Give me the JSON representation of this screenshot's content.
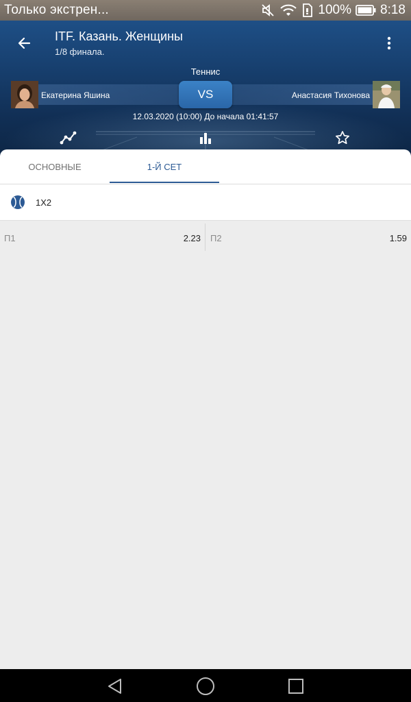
{
  "status_bar": {
    "notification": "Только экстрен...",
    "battery": "100%",
    "time": "8:18",
    "icons": [
      "mute-icon",
      "wifi-icon",
      "sim-icon",
      "battery-icon"
    ]
  },
  "header": {
    "title": "ITF. Казань. Женщины",
    "subtitle": "1/8 финала.",
    "sport": "Теннис",
    "vs": "VS",
    "datetime": "12.03.2020 (10:00) До начала 01:41:57",
    "player_left": "Екатерина Яшина",
    "player_right": "Анастасия Тихонова",
    "icons": [
      "back-arrow-icon",
      "more-vert-icon",
      "chart-line-icon",
      "stats-bars-icon",
      "star-icon"
    ]
  },
  "tabs": [
    {
      "label": "ОСНОВНЫЕ",
      "active": false
    },
    {
      "label": "1-Й СЕТ",
      "active": true
    }
  ],
  "market": {
    "title": "1X2",
    "icon": "tennis-ball-icon",
    "odds": [
      {
        "label": "П1",
        "value": "2.23"
      },
      {
        "label": "П2",
        "value": "1.59"
      }
    ]
  },
  "colors": {
    "accent": "#2c5a94",
    "header_dark": "#0d2645",
    "header_light": "#1e4f86",
    "background": "#ededed"
  }
}
